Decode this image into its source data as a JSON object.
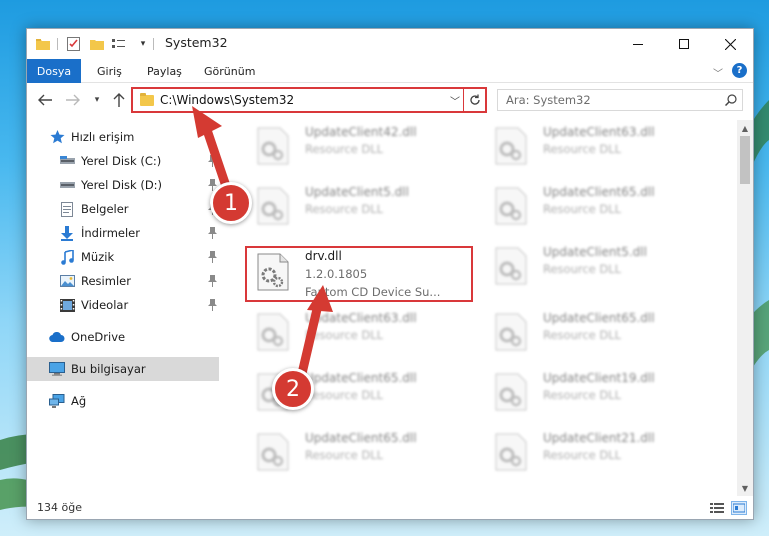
{
  "window": {
    "title": "System32",
    "controls": {
      "minimize": "minimize-icon",
      "maximize": "maximize-icon",
      "close": "close-icon"
    }
  },
  "ribbon": {
    "tabs": [
      {
        "label": "Dosya"
      },
      {
        "label": "Giriş"
      },
      {
        "label": "Paylaş"
      },
      {
        "label": "Görünüm"
      }
    ],
    "help": "?"
  },
  "navigation": {
    "address": "C:\\Windows\\System32",
    "search_placeholder": "Ara: System32"
  },
  "sidebar": {
    "items": [
      {
        "label": "Hızlı erişim",
        "icon": "star-icon",
        "pinned": false
      },
      {
        "label": "Yerel Disk (C:)",
        "icon": "drive-icon",
        "pinned": true
      },
      {
        "label": "Yerel Disk (D:)",
        "icon": "drive-icon",
        "pinned": true
      },
      {
        "label": "Belgeler",
        "icon": "documents-icon",
        "pinned": true
      },
      {
        "label": "İndirmeler",
        "icon": "download-icon",
        "pinned": true
      },
      {
        "label": "Müzik",
        "icon": "music-icon",
        "pinned": true
      },
      {
        "label": "Resimler",
        "icon": "pictures-icon",
        "pinned": true
      },
      {
        "label": "Videolar",
        "icon": "video-icon",
        "pinned": true
      },
      {
        "label": "OneDrive",
        "icon": "cloud-icon",
        "pinned": false
      },
      {
        "label": "Bu bilgisayar",
        "icon": "computer-icon",
        "pinned": false,
        "selected": true
      },
      {
        "label": "Ağ",
        "icon": "network-icon",
        "pinned": false
      }
    ]
  },
  "files": {
    "left": [
      {
        "name": "UpdateClient42.dll",
        "sub1": "Resource DLL",
        "sub2": ""
      },
      {
        "name": "UpdateClient5.dll",
        "sub1": "Resource DLL",
        "sub2": ""
      },
      {
        "name": "drv.dll",
        "sub1": "1.2.0.1805",
        "sub2": "Fantom CD Device Su..."
      },
      {
        "name": "UpdateClient63.dll",
        "sub1": "Resource DLL",
        "sub2": ""
      },
      {
        "name": "UpdateClient65.dll",
        "sub1": "Resource DLL",
        "sub2": ""
      },
      {
        "name": "UpdateClient65.dll",
        "sub1": "Resource DLL",
        "sub2": ""
      }
    ],
    "right": [
      {
        "name": "UpdateClient63.dll",
        "sub1": "Resource DLL",
        "sub2": ""
      },
      {
        "name": "UpdateClient65.dll",
        "sub1": "Resource DLL",
        "sub2": ""
      },
      {
        "name": "UpdateClient5.dll",
        "sub1": "Resource DLL",
        "sub2": ""
      },
      {
        "name": "UpdateClient65.dll",
        "sub1": "Resource DLL",
        "sub2": ""
      },
      {
        "name": "UpdateClient19.dll",
        "sub1": "Resource DLL",
        "sub2": ""
      },
      {
        "name": "UpdateClient21.dll",
        "sub1": "Resource DLL",
        "sub2": ""
      }
    ]
  },
  "status": {
    "item_count": "134 öğe"
  },
  "annotations": {
    "step1": "1",
    "step2": "2"
  },
  "colors": {
    "accent": "#1a6fc9",
    "highlight": "#d9383a",
    "badge": "#d43a32"
  }
}
